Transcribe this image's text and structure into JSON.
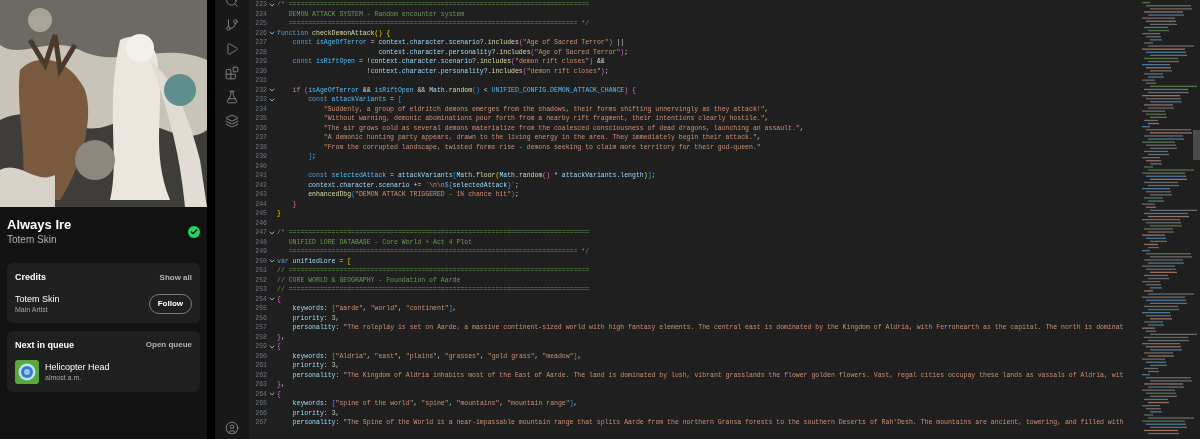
{
  "now_playing": {
    "title": "Always Ire",
    "artist": "Totem Skin",
    "saved": true,
    "credits": {
      "heading": "Credits",
      "show_all": "Show all",
      "artists": [
        {
          "name": "Totem Skin",
          "role": "Main Artist",
          "follow": "Follow"
        }
      ]
    },
    "queue": {
      "heading": "Next in queue",
      "open": "Open queue",
      "items": [
        {
          "title": "Helicopter Head",
          "artist": "almost a.m."
        }
      ]
    }
  },
  "editor": {
    "lines": [
      {
        "number": "223",
        "fold": true,
        "tokens": [
          {
            "kind": "comment",
            "text": "/* ============================================================================="
          }
        ]
      },
      {
        "number": "224",
        "fold": false,
        "tokens": [
          {
            "kind": "comment",
            "text": "   DEMON ATTACK SYSTEM - Random encounter system"
          }
        ]
      },
      {
        "number": "225",
        "fold": false,
        "tokens": [
          {
            "kind": "comment",
            "text": "   ========================================================================== */"
          }
        ]
      },
      {
        "number": "226",
        "fold": true,
        "tokens": [
          {
            "kind": "keyword",
            "text": "function "
          },
          {
            "kind": "function",
            "text": "checkDemonAttack"
          },
          {
            "kind": "bracket1",
            "text": "() {"
          }
        ]
      },
      {
        "number": "227",
        "fold": false,
        "tokens": [
          {
            "kind": "keyword",
            "text": "    const "
          },
          {
            "kind": "constant",
            "text": "isAgeOfTerror"
          },
          {
            "kind": "plain",
            "text": " = "
          },
          {
            "kind": "variable",
            "text": "context.character.scenario"
          },
          {
            "kind": "plain",
            "text": "?."
          },
          {
            "kind": "function",
            "text": "includes"
          },
          {
            "kind": "bracket2",
            "text": "("
          },
          {
            "kind": "string",
            "text": "\"Age of Sacred Terror\""
          },
          {
            "kind": "bracket2",
            "text": ")"
          },
          {
            "kind": "plain",
            "text": " ||"
          }
        ]
      },
      {
        "number": "228",
        "fold": false,
        "tokens": [
          {
            "kind": "variable",
            "text": "                          context.character.personality"
          },
          {
            "kind": "plain",
            "text": "?."
          },
          {
            "kind": "function",
            "text": "includes"
          },
          {
            "kind": "bracket2",
            "text": "("
          },
          {
            "kind": "string",
            "text": "\"Age of Sacred Terror\""
          },
          {
            "kind": "bracket2",
            "text": ")"
          },
          {
            "kind": "plain",
            "text": ";"
          }
        ]
      },
      {
        "number": "229",
        "fold": false,
        "tokens": [
          {
            "kind": "keyword",
            "text": "    const "
          },
          {
            "kind": "constant",
            "text": "isRiftOpen"
          },
          {
            "kind": "plain",
            "text": " = !"
          },
          {
            "kind": "variable",
            "text": "context.character.scenario"
          },
          {
            "kind": "plain",
            "text": "?."
          },
          {
            "kind": "function",
            "text": "includes"
          },
          {
            "kind": "bracket2",
            "text": "("
          },
          {
            "kind": "string",
            "text": "\"demon rift closes\""
          },
          {
            "kind": "bracket2",
            "text": ")"
          },
          {
            "kind": "plain",
            "text": " &&"
          }
        ]
      },
      {
        "number": "230",
        "fold": false,
        "tokens": [
          {
            "kind": "plain",
            "text": "                       !"
          },
          {
            "kind": "variable",
            "text": "context.character.personality"
          },
          {
            "kind": "plain",
            "text": "?."
          },
          {
            "kind": "function",
            "text": "includes"
          },
          {
            "kind": "bracket2",
            "text": "("
          },
          {
            "kind": "string",
            "text": "\"demon rift closes\""
          },
          {
            "kind": "bracket2",
            "text": ")"
          },
          {
            "kind": "plain",
            "text": ";"
          }
        ]
      },
      {
        "number": "231",
        "fold": false
      },
      {
        "number": "232",
        "fold": true,
        "tokens": [
          {
            "kind": "control",
            "text": "    if "
          },
          {
            "kind": "bracket2",
            "text": "("
          },
          {
            "kind": "constant",
            "text": "isAgeOfTerror"
          },
          {
            "kind": "plain",
            "text": " && "
          },
          {
            "kind": "constant",
            "text": "isRiftOpen"
          },
          {
            "kind": "plain",
            "text": " && "
          },
          {
            "kind": "variable",
            "text": "Math"
          },
          {
            "kind": "plain",
            "text": "."
          },
          {
            "kind": "function",
            "text": "random"
          },
          {
            "kind": "bracket3",
            "text": "()"
          },
          {
            "kind": "plain",
            "text": " < "
          },
          {
            "kind": "constant",
            "text": "UNIFIED_CONFIG.DEMON_ATTACK_CHANCE"
          },
          {
            "kind": "bracket2",
            "text": ")"
          },
          {
            "kind": "bracket2",
            "text": " {"
          }
        ]
      },
      {
        "number": "233",
        "fold": true,
        "tokens": [
          {
            "kind": "keyword",
            "text": "        const "
          },
          {
            "kind": "constant",
            "text": "attackVariants"
          },
          {
            "kind": "plain",
            "text": " = "
          },
          {
            "kind": "bracket3",
            "text": "["
          }
        ]
      },
      {
        "number": "234",
        "fold": false,
        "tokens": [
          {
            "kind": "string",
            "text": "            \"Suddenly, a group of eldritch demons emerges from the shadows, their forms shifting unnervingly as they attack!\""
          },
          {
            "kind": "plain",
            "text": ","
          }
        ]
      },
      {
        "number": "235",
        "fold": false,
        "tokens": [
          {
            "kind": "string",
            "text": "            \"Without warning, demonic abominations pour forth from a nearby rift fragment, their intentions clearly hostile.\""
          },
          {
            "kind": "plain",
            "text": ","
          }
        ]
      },
      {
        "number": "236",
        "fold": false,
        "tokens": [
          {
            "kind": "string",
            "text": "            \"The air grows cold as several demons materialize from the coalesced consciousness of dead dragons, launching an assault.\""
          },
          {
            "kind": "plain",
            "text": ","
          }
        ]
      },
      {
        "number": "237",
        "fold": false,
        "tokens": [
          {
            "kind": "string",
            "text": "            \"A demonic hunting party appears, drawn to the living energy in the area. They immediately begin their attack.\""
          },
          {
            "kind": "plain",
            "text": ","
          }
        ]
      },
      {
        "number": "238",
        "fold": false,
        "tokens": [
          {
            "kind": "string",
            "text": "            \"From the corrupted landscape, twisted forms rise - demons seeking to claim more territory for their god-queen.\""
          }
        ]
      },
      {
        "number": "239",
        "fold": false,
        "tokens": [
          {
            "kind": "bracket3",
            "text": "        ]"
          },
          {
            "kind": "plain",
            "text": ";"
          }
        ]
      },
      {
        "number": "240",
        "fold": false
      },
      {
        "number": "241",
        "fold": false,
        "tokens": [
          {
            "kind": "keyword",
            "text": "        const "
          },
          {
            "kind": "constant",
            "text": "selectedAttack"
          },
          {
            "kind": "plain",
            "text": " = "
          },
          {
            "kind": "variable",
            "text": "attackVariants"
          },
          {
            "kind": "bracket3",
            "text": "["
          },
          {
            "kind": "variable",
            "text": "Math"
          },
          {
            "kind": "plain",
            "text": "."
          },
          {
            "kind": "function",
            "text": "floor"
          },
          {
            "kind": "bracket1",
            "text": "("
          },
          {
            "kind": "variable",
            "text": "Math"
          },
          {
            "kind": "plain",
            "text": "."
          },
          {
            "kind": "function",
            "text": "random"
          },
          {
            "kind": "bracket2",
            "text": "()"
          },
          {
            "kind": "plain",
            "text": " * "
          },
          {
            "kind": "variable",
            "text": "attackVariants.length"
          },
          {
            "kind": "bracket1",
            "text": ")"
          },
          {
            "kind": "bracket3",
            "text": "]"
          },
          {
            "kind": "plain",
            "text": ";"
          }
        ]
      },
      {
        "number": "242",
        "fold": false,
        "tokens": [
          {
            "kind": "variable",
            "text": "        context.character.scenario"
          },
          {
            "kind": "plain",
            "text": " += "
          },
          {
            "kind": "string",
            "text": "`\\n\\n"
          },
          {
            "kind": "keyword",
            "text": "${"
          },
          {
            "kind": "variable",
            "text": "selectedAttack"
          },
          {
            "kind": "keyword",
            "text": "}"
          },
          {
            "kind": "string",
            "text": "`"
          },
          {
            "kind": "plain",
            "text": ";"
          }
        ]
      },
      {
        "number": "243",
        "fold": false,
        "tokens": [
          {
            "kind": "function",
            "text": "        enhancedDbg"
          },
          {
            "kind": "bracket3",
            "text": "("
          },
          {
            "kind": "string",
            "text": "\"DEMON ATTACK TRIGGERED - 1% chance hit\""
          },
          {
            "kind": "bracket3",
            "text": ")"
          },
          {
            "kind": "plain",
            "text": ";"
          }
        ]
      },
      {
        "number": "244",
        "fold": false,
        "tokens": [
          {
            "kind": "bracket2",
            "text": "    }"
          }
        ]
      },
      {
        "number": "245",
        "fold": false,
        "tokens": [
          {
            "kind": "bracket1",
            "text": "}"
          }
        ]
      },
      {
        "number": "246",
        "fold": false
      },
      {
        "number": "247",
        "fold": true,
        "tokens": [
          {
            "kind": "comment",
            "text": "/* ============================================================================="
          }
        ]
      },
      {
        "number": "248",
        "fold": false,
        "tokens": [
          {
            "kind": "comment",
            "text": "   UNIFIED LORE DATABASE - Core World + Act 4 Plot"
          }
        ]
      },
      {
        "number": "249",
        "fold": false,
        "tokens": [
          {
            "kind": "comment",
            "text": "   ========================================================================== */"
          }
        ]
      },
      {
        "number": "250",
        "fold": true,
        "tokens": [
          {
            "kind": "keyword",
            "text": "var "
          },
          {
            "kind": "variable",
            "text": "unifiedLore"
          },
          {
            "kind": "plain",
            "text": " = "
          },
          {
            "kind": "bracket1",
            "text": "["
          }
        ]
      },
      {
        "number": "251",
        "fold": false,
        "tokens": [
          {
            "kind": "comment",
            "text": "// ============================================================================="
          }
        ]
      },
      {
        "number": "252",
        "fold": false,
        "tokens": [
          {
            "kind": "comment",
            "text": "// CORE WORLD & GEOGRAPHY - Foundation of Aarde"
          }
        ]
      },
      {
        "number": "253",
        "fold": false,
        "tokens": [
          {
            "kind": "comment",
            "text": "// ============================================================================="
          }
        ]
      },
      {
        "number": "254",
        "fold": true,
        "tokens": [
          {
            "kind": "bracket2",
            "text": "{"
          }
        ]
      },
      {
        "number": "255",
        "fold": false,
        "tokens": [
          {
            "kind": "variable",
            "text": "    keywords"
          },
          {
            "kind": "plain",
            "text": ": "
          },
          {
            "kind": "bracket3",
            "text": "["
          },
          {
            "kind": "string",
            "text": "\"aarde\""
          },
          {
            "kind": "plain",
            "text": ", "
          },
          {
            "kind": "string",
            "text": "\"world\""
          },
          {
            "kind": "plain",
            "text": ", "
          },
          {
            "kind": "string",
            "text": "\"continent\""
          },
          {
            "kind": "bracket3",
            "text": "]"
          },
          {
            "kind": "plain",
            "text": ","
          }
        ]
      },
      {
        "number": "256",
        "fold": false,
        "tokens": [
          {
            "kind": "variable",
            "text": "    priority"
          },
          {
            "kind": "plain",
            "text": ": "
          },
          {
            "kind": "number",
            "text": "3"
          },
          {
            "kind": "plain",
            "text": ","
          }
        ]
      },
      {
        "number": "257",
        "fold": false,
        "tokens": [
          {
            "kind": "variable",
            "text": "    personality"
          },
          {
            "kind": "plain",
            "text": ": "
          },
          {
            "kind": "string",
            "text": "\"The roleplay is set on Aarde, a massive continent-sized world with high fantasy elements. The central east is dominated by the Kingdom of Aldria, with Ferrohearth as the capital. The north is dominat"
          }
        ]
      },
      {
        "number": "258",
        "fold": false,
        "tokens": [
          {
            "kind": "bracket2",
            "text": "}"
          },
          {
            "kind": "plain",
            "text": ","
          }
        ]
      },
      {
        "number": "259",
        "fold": true,
        "tokens": [
          {
            "kind": "bracket2",
            "text": "{"
          }
        ]
      },
      {
        "number": "260",
        "fold": false,
        "tokens": [
          {
            "kind": "variable",
            "text": "    keywords"
          },
          {
            "kind": "plain",
            "text": ": "
          },
          {
            "kind": "bracket3",
            "text": "["
          },
          {
            "kind": "string",
            "text": "\"Aldria\""
          },
          {
            "kind": "plain",
            "text": ", "
          },
          {
            "kind": "string",
            "text": "\"east\""
          },
          {
            "kind": "plain",
            "text": ", "
          },
          {
            "kind": "string",
            "text": "\"plains\""
          },
          {
            "kind": "plain",
            "text": ", "
          },
          {
            "kind": "string",
            "text": "\"grasses\""
          },
          {
            "kind": "plain",
            "text": ", "
          },
          {
            "kind": "string",
            "text": "\"gold grass\""
          },
          {
            "kind": "plain",
            "text": ", "
          },
          {
            "kind": "string",
            "text": "\"meadow\""
          },
          {
            "kind": "bracket3",
            "text": "]"
          },
          {
            "kind": "plain",
            "text": ","
          }
        ]
      },
      {
        "number": "261",
        "fold": false,
        "tokens": [
          {
            "kind": "variable",
            "text": "    priority"
          },
          {
            "kind": "plain",
            "text": ": "
          },
          {
            "kind": "number",
            "text": "3"
          },
          {
            "kind": "plain",
            "text": ","
          }
        ]
      },
      {
        "number": "262",
        "fold": false,
        "tokens": [
          {
            "kind": "variable",
            "text": "    personality"
          },
          {
            "kind": "plain",
            "text": ": "
          },
          {
            "kind": "string",
            "text": "\"The Kingdom of Aldria inhabits most of the East of Aarde. The land is dominated by lush, vibrant grasslands the flower golden flowers. Vast, regal cities occupay these lands as vassals of Aldria, wit"
          }
        ]
      },
      {
        "number": "263",
        "fold": false,
        "tokens": [
          {
            "kind": "bracket2",
            "text": "}"
          },
          {
            "kind": "plain",
            "text": ","
          }
        ]
      },
      {
        "number": "264",
        "fold": true,
        "tokens": [
          {
            "kind": "bracket2",
            "text": "{"
          }
        ]
      },
      {
        "number": "265",
        "fold": false,
        "tokens": [
          {
            "kind": "variable",
            "text": "    keywords"
          },
          {
            "kind": "plain",
            "text": ": "
          },
          {
            "kind": "bracket3",
            "text": "["
          },
          {
            "kind": "string",
            "text": "\"spine of the world\""
          },
          {
            "kind": "plain",
            "text": ", "
          },
          {
            "kind": "string",
            "text": "\"spine\""
          },
          {
            "kind": "plain",
            "text": ", "
          },
          {
            "kind": "string",
            "text": "\"mountains\""
          },
          {
            "kind": "plain",
            "text": ", "
          },
          {
            "kind": "string",
            "text": "\"mountain range\""
          },
          {
            "kind": "bracket3",
            "text": "]"
          },
          {
            "kind": "plain",
            "text": ","
          }
        ]
      },
      {
        "number": "266",
        "fold": false,
        "tokens": [
          {
            "kind": "variable",
            "text": "    priority"
          },
          {
            "kind": "plain",
            "text": ": "
          },
          {
            "kind": "number",
            "text": "3"
          },
          {
            "kind": "plain",
            "text": ","
          }
        ]
      },
      {
        "number": "267",
        "fold": false,
        "tokens": [
          {
            "kind": "variable",
            "text": "    personality"
          },
          {
            "kind": "plain",
            "text": ": "
          },
          {
            "kind": "string",
            "text": "\"The Spine of the World is a near-impassable mountain range that splits Aarde from the northern Gransa forests to the southern Deserts of Rah'Desh. The mountains are ancient, towering, and filled with"
          }
        ]
      }
    ]
  }
}
